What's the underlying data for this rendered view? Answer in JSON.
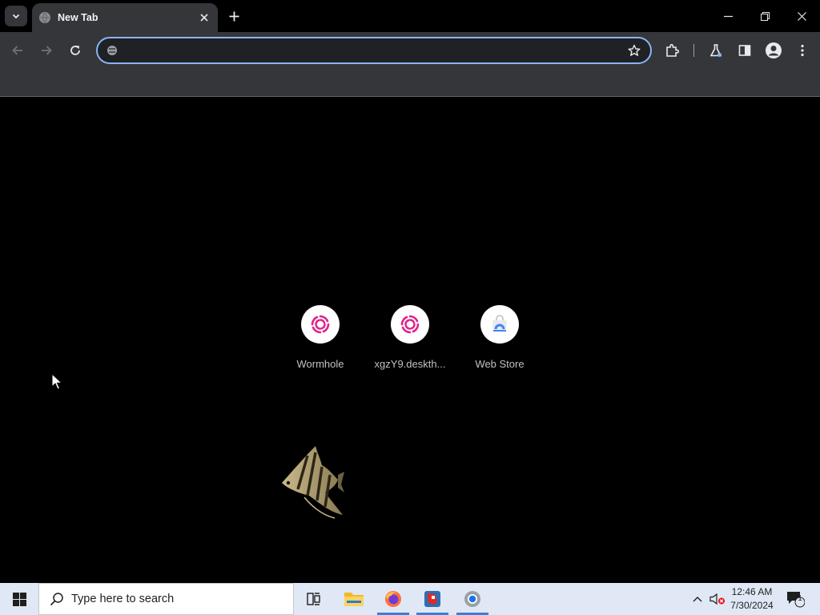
{
  "browser": {
    "tab": {
      "title": "New Tab"
    },
    "omnibox": {
      "value": "",
      "placeholder": ""
    }
  },
  "shortcuts": [
    {
      "label": "Wormhole",
      "icon": "wormhole-icon"
    },
    {
      "label": "xgzY9.deskth...",
      "icon": "wormhole-icon"
    },
    {
      "label": "Web Store",
      "icon": "web-store-icon"
    }
  ],
  "taskbar": {
    "search_placeholder": "Type here to search",
    "time": "12:46 AM",
    "date": "7/30/2024",
    "notification_count": "1"
  },
  "colors": {
    "focus_ring": "#8ab4f8",
    "toolbar_bg": "#35363a",
    "wormhole_pink": "#e3238b",
    "taskbar_bg": "#dfe8f4"
  }
}
